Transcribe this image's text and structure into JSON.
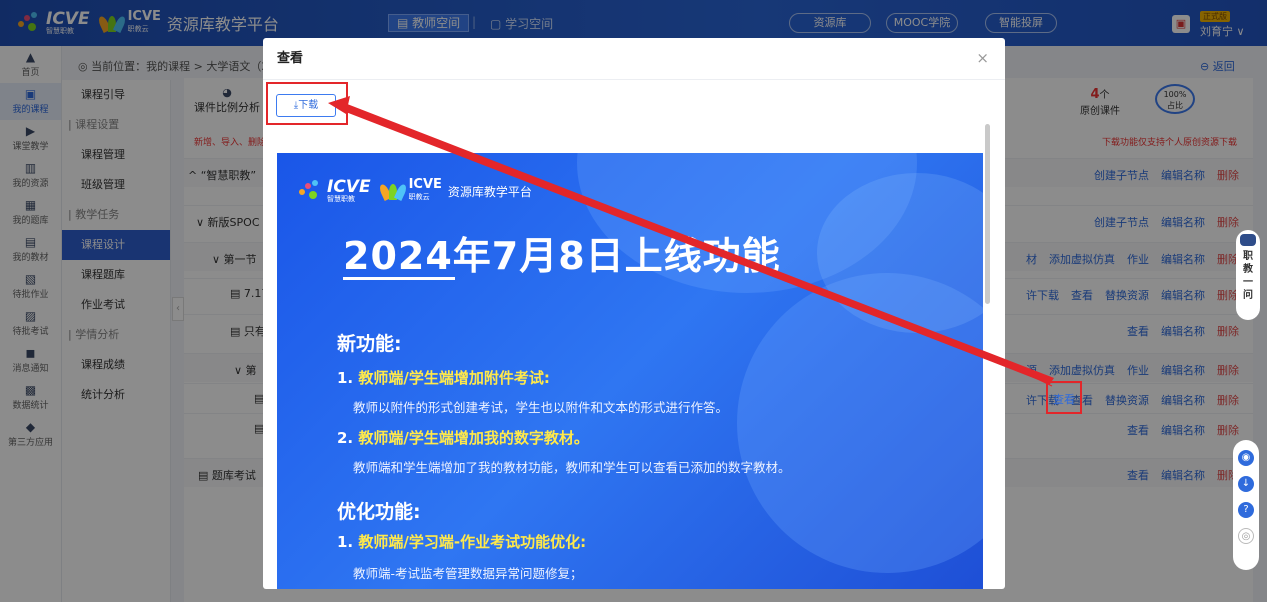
{
  "header": {
    "platform": "资源库教学平台",
    "icve": "ICVE",
    "icve_sub": "智慧职教",
    "zjy": "ICVE",
    "zjy_sub": "职教云",
    "nav_teacher": "教师空间",
    "nav_student": "学习空间",
    "pills": [
      "资源库",
      "MOOC学院",
      "智能投屏"
    ],
    "badge": "正式版",
    "user": "刘育宁"
  },
  "rail": [
    {
      "icon": "home-icon",
      "glyph": "▲",
      "label": "首页"
    },
    {
      "icon": "course-icon",
      "glyph": "▣",
      "label": "我的课程"
    },
    {
      "icon": "classroom-icon",
      "glyph": "▶",
      "label": "课堂教学"
    },
    {
      "icon": "resource-icon",
      "glyph": "▥",
      "label": "我的资源"
    },
    {
      "icon": "question-bank-icon",
      "glyph": "▦",
      "label": "我的题库"
    },
    {
      "icon": "textbook-icon",
      "glyph": "▤",
      "label": "我的教材"
    },
    {
      "icon": "homework-icon",
      "glyph": "▧",
      "label": "待批作业"
    },
    {
      "icon": "exam-icon",
      "glyph": "▨",
      "label": "待批考试"
    },
    {
      "icon": "message-icon",
      "glyph": "◼",
      "label": "消息通知"
    },
    {
      "icon": "statistics-icon",
      "glyph": "▩",
      "label": "数据统计"
    },
    {
      "icon": "apps-icon",
      "glyph": "◆",
      "label": "第三方应用"
    }
  ],
  "breadcrumb": "当前位置：我的课程 > 大学语文（2P",
  "back": "返回",
  "menu2": [
    {
      "label": "课程引导",
      "type": "item"
    },
    {
      "label": "课程设置",
      "type": "group"
    },
    {
      "label": "课程管理",
      "type": "item"
    },
    {
      "label": "班级管理",
      "type": "item"
    },
    {
      "label": "教学任务",
      "type": "group"
    },
    {
      "label": "课程设计",
      "type": "active"
    },
    {
      "label": "课程题库",
      "type": "item"
    },
    {
      "label": "作业考试",
      "type": "item"
    },
    {
      "label": "学情分析",
      "type": "group"
    },
    {
      "label": "课程成绩",
      "type": "item"
    },
    {
      "label": "统计分析",
      "type": "item"
    }
  ],
  "stats": {
    "ratio_label": "课件比例分析",
    "original_count": "4",
    "original_unit": "个",
    "original_label": "原创课件",
    "percent": "100%",
    "percent_label": "占比",
    "note_left": "新增、导入、删除",
    "note_right": "下载功能仅支持个人原创资源下载"
  },
  "rows": [
    {
      "label": "^ “智慧职教”",
      "actions": [
        "创建子节点",
        "编辑名称"
      ],
      "del": "删除"
    },
    {
      "label": "∨ 新版SPOC",
      "actions": [
        "创建子节点",
        "编辑名称"
      ],
      "del": "删除"
    },
    {
      "label": "∨ 第一节",
      "actions": [
        "材",
        "添加虚拟仿真",
        "作业",
        "编辑名称"
      ],
      "del": "删除"
    },
    {
      "label": "▤ 7.17",
      "actions": [
        "许下载",
        "查看",
        "替换资源",
        "编辑名称"
      ],
      "del": "删除"
    },
    {
      "label": "▤ 只有",
      "actions": [
        "查看",
        "编辑名称"
      ],
      "del": "删除"
    },
    {
      "label": "∨ 第",
      "actions": [
        "源",
        "添加虚拟仿真",
        "作业",
        "编辑名称"
      ],
      "del": "删除"
    },
    {
      "label": "▤",
      "actions": [
        "许下载",
        "查看",
        "替换资源",
        "编辑名称"
      ],
      "del": "删除"
    },
    {
      "label": "▤",
      "actions": [
        "查看",
        "编辑名称"
      ],
      "del": "删除"
    },
    {
      "label": "▤ 题库考试（",
      "actions": [
        "查看",
        "编辑名称"
      ],
      "del": "删除"
    }
  ],
  "robot": "职教一问",
  "modal": {
    "title": "查看",
    "download": "下载"
  },
  "poster": {
    "platform": "资源库教学平台",
    "title": "2024年7月8日上线功能",
    "new_heading": "新功能:",
    "items": [
      {
        "num": "1.",
        "text": "教师端/学生端增加附件考试:",
        "desc": "教师以附件的形式创建考试，学生也以附件和文本的形式进行作答。"
      },
      {
        "num": "2.",
        "text": "教师端/学生端增加我的数字教材。",
        "desc": "教师端和学生端增加了我的教材功能，教师和学生可以查看已添加的数字教材。"
      }
    ],
    "opt_heading": "优化功能:",
    "opt_items": [
      {
        "num": "1.",
        "text": "教师端/学习端-作业考试功能优化:",
        "desc": "教师端-考试监考管理数据异常问题修复；"
      }
    ]
  }
}
